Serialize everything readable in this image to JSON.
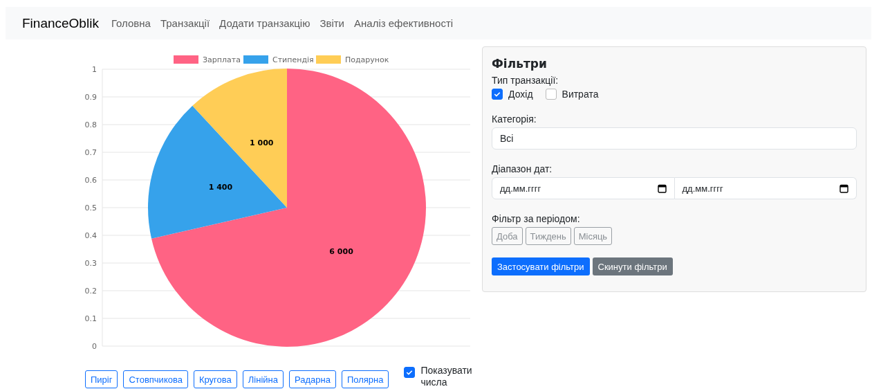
{
  "navbar": {
    "brand": "FinanceOblik",
    "links": [
      {
        "label": "Головна"
      },
      {
        "label": "Транзакції"
      },
      {
        "label": "Додати транзакцію"
      },
      {
        "label": "Звіти"
      },
      {
        "label": "Аналіз ефективності"
      }
    ]
  },
  "chart": {
    "chart_data": {
      "type": "pie",
      "categories": [
        "Зарплата",
        "Стипендія",
        "Подарунок"
      ],
      "values": [
        6000,
        1400,
        1000
      ],
      "legend": "top",
      "colors": [
        "#ff6384",
        "#36a2eb",
        "#ffcd56"
      ],
      "value_labels": [
        "6 000",
        "1 400",
        "1 000"
      ]
    },
    "axis_labels": [
      "1",
      "0.9",
      "0.8",
      "0.7",
      "0.6",
      "0.5",
      "0.4",
      "0.3",
      "0.2",
      "0.1",
      "0"
    ]
  },
  "chart_buttons": [
    {
      "label": "Пиріг"
    },
    {
      "label": "Стовпчикова"
    },
    {
      "label": "Кругова"
    },
    {
      "label": "Лінійна"
    },
    {
      "label": "Радарна"
    },
    {
      "label": "Полярна"
    }
  ],
  "show_numbers": {
    "label": "Показувати числа",
    "checked": true
  },
  "filters": {
    "title": "Фільтри",
    "type_label": "Тип транзакції:",
    "types": [
      {
        "label": "Дохід",
        "checked": true
      },
      {
        "label": "Витрата",
        "checked": false
      }
    ],
    "category_label": "Категорія:",
    "category_value": "Всі",
    "date_label": "Діапазон дат:",
    "date_from": "дд.мм.гггг",
    "date_to": "дд.мм.гггг",
    "period_label": "Фільтр за періодом:",
    "periods": [
      {
        "label": "Доба",
        "disabled": true
      },
      {
        "label": "Тиждень",
        "disabled": true
      },
      {
        "label": "Місяць",
        "disabled": true
      }
    ],
    "apply": "Застосувати фільтри",
    "reset": "Скинути фільтри"
  }
}
